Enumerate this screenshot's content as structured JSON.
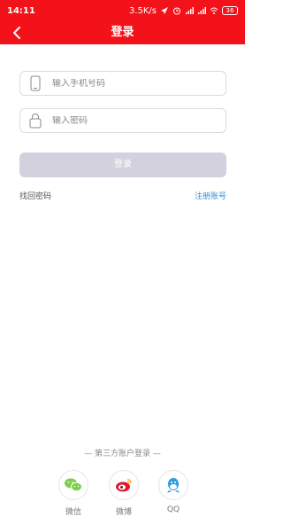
{
  "status": {
    "time": "14:11",
    "net_speed": "3.5K/s",
    "battery": "36"
  },
  "header": {
    "title": "登录"
  },
  "form": {
    "phone_placeholder": "输入手机号码",
    "password_placeholder": "输入密码",
    "login_label": "登录"
  },
  "links": {
    "forgot_password": "找回密码",
    "register": "注册账号"
  },
  "third_party": {
    "title": "— 第三方账户登录 —",
    "items": [
      {
        "label": "微信",
        "icon": "wechat-icon",
        "color": "#7ccf4a"
      },
      {
        "label": "微博",
        "icon": "weibo-icon",
        "color": "#e6162d"
      },
      {
        "label": "QQ",
        "icon": "qq-icon",
        "color": "#2f9be4"
      }
    ]
  },
  "colors": {
    "brand_red": "#f3121a",
    "button_disabled": "#d2d1dd",
    "link_blue": "#2f8fe0"
  }
}
